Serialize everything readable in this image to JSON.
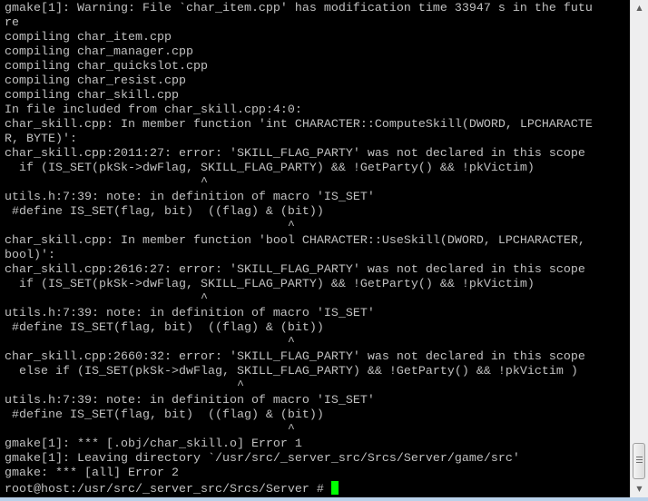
{
  "terminal": {
    "text_color": "#c0c0c0",
    "background": "#000000",
    "cursor_color": "#00ff00",
    "lines": [
      "gmake[1]: Warning: File `char_item.cpp' has modification time 33947 s in the futu",
      "re",
      "compiling char_item.cpp",
      "compiling char_manager.cpp",
      "compiling char_quickslot.cpp",
      "compiling char_resist.cpp",
      "compiling char_skill.cpp",
      "In file included from char_skill.cpp:4:0:",
      "char_skill.cpp: In member function 'int CHARACTER::ComputeSkill(DWORD, LPCHARACTE",
      "R, BYTE)':",
      "char_skill.cpp:2011:27: error: 'SKILL_FLAG_PARTY' was not declared in this scope",
      "  if (IS_SET(pkSk->dwFlag, SKILL_FLAG_PARTY) && !GetParty() && !pkVictim)",
      "                           ^",
      "utils.h:7:39: note: in definition of macro 'IS_SET'",
      " #define IS_SET(flag, bit)  ((flag) & (bit))",
      "                                       ^",
      "char_skill.cpp: In member function 'bool CHARACTER::UseSkill(DWORD, LPCHARACTER,",
      "bool)':",
      "char_skill.cpp:2616:27: error: 'SKILL_FLAG_PARTY' was not declared in this scope",
      "  if (IS_SET(pkSk->dwFlag, SKILL_FLAG_PARTY) && !GetParty() && !pkVictim)",
      "                           ^",
      "utils.h:7:39: note: in definition of macro 'IS_SET'",
      " #define IS_SET(flag, bit)  ((flag) & (bit))",
      "                                       ^",
      "char_skill.cpp:2660:32: error: 'SKILL_FLAG_PARTY' was not declared in this scope",
      "  else if (IS_SET(pkSk->dwFlag, SKILL_FLAG_PARTY) && !GetParty() && !pkVictim )",
      "                                ^",
      "utils.h:7:39: note: in definition of macro 'IS_SET'",
      " #define IS_SET(flag, bit)  ((flag) & (bit))",
      "                                       ^",
      "gmake[1]: *** [.obj/char_skill.o] Error 1",
      "gmake[1]: Leaving directory `/usr/src/_server_src/Srcs/Server/game/src'",
      "gmake: *** [all] Error 2"
    ],
    "prompt": "root@host:/usr/src/_server_src/Srcs/Server # "
  },
  "scrollbar": {
    "up_icon": "triangle-up",
    "down_icon": "triangle-down",
    "position_percent": 100
  }
}
